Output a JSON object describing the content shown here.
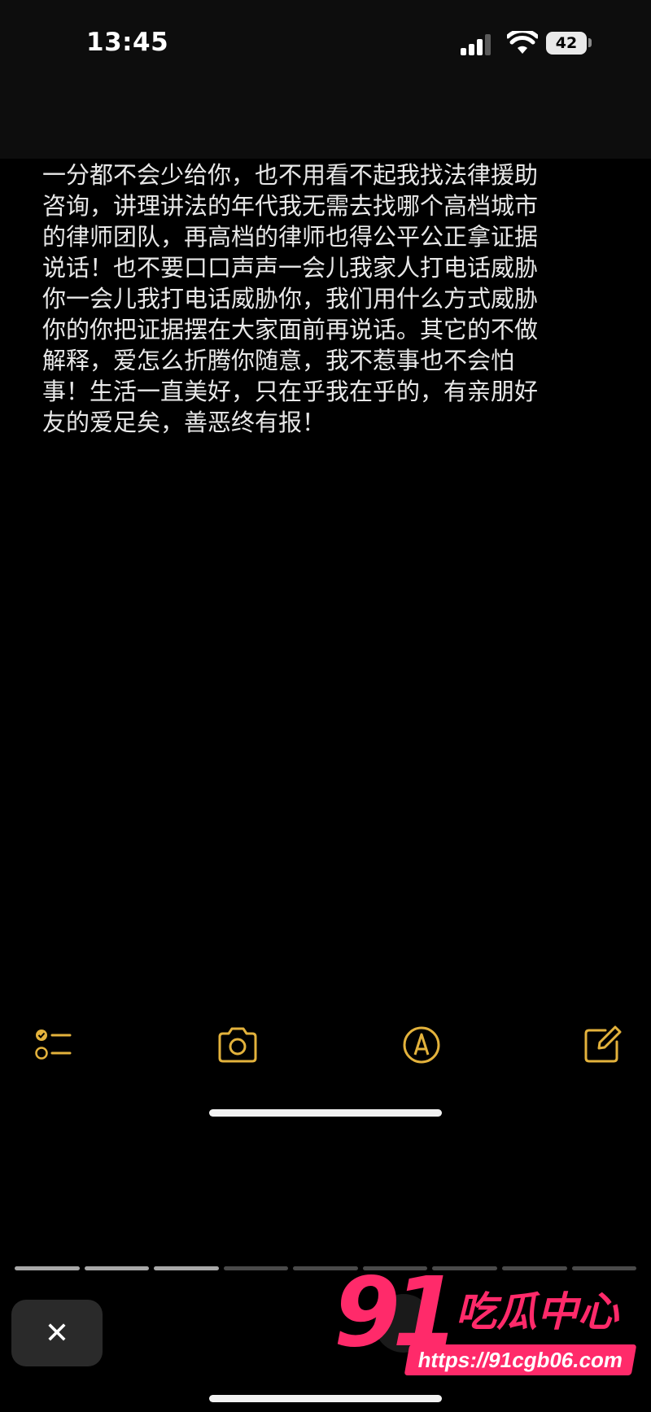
{
  "status_bar": {
    "time": "13:45",
    "battery": "42"
  },
  "note": {
    "lines": [
      "一分都不会少给你，也不用看不起我找法律援助",
      "咨询，讲理讲法的年代我无需去找哪个高档城市",
      "的律师团队，再高档的律师也得公平公正拿证据",
      "说话！也不要口口声声一会儿我家人打电话威胁",
      "你一会儿我打电话威胁你，我们用什么方式威胁",
      "你的你把证据摆在大家面前再说话。其它的不做",
      "解释，爱怎么折腾你随意，我不惹事也不会怕",
      "事！生活一直美好，只在乎我在乎的，有亲朋好",
      "友的爱足矣，善恶终有报！"
    ]
  },
  "toolbar": {
    "items": [
      "checklist-icon",
      "camera-icon",
      "markup-icon",
      "compose-icon"
    ],
    "accent": "#e3b23c"
  },
  "story": {
    "segments_total": 9,
    "segments_viewed": 3,
    "close_label": "✕"
  },
  "watermark": {
    "number": "91",
    "name": "吃瓜中心",
    "url": "https://91cgb06.com",
    "color": "#ff2a6a"
  }
}
